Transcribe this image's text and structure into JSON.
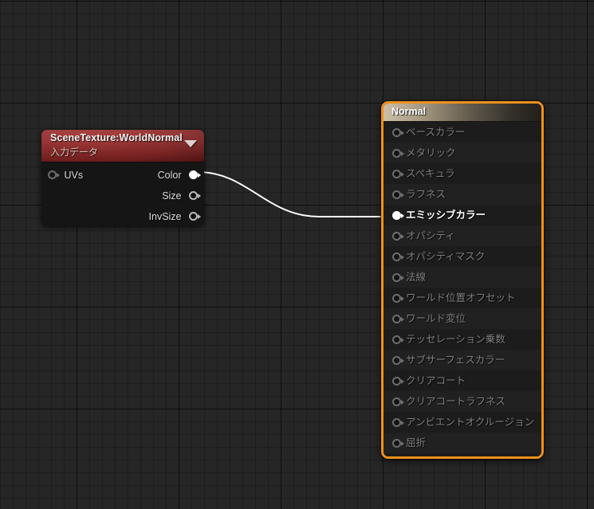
{
  "app": {
    "context": "unreal-engine-material-graph",
    "accent_selection_color": "#f0911a",
    "wire_color": "#ffffff",
    "canvas_color": "#262626"
  },
  "scene_texture_node": {
    "title": "SceneTexture:WorldNormal",
    "subtitle": "入力データ",
    "header_color": "#8d2424",
    "collapse_arrow_icon": "chevron-down-icon",
    "inputs": [
      {
        "label": "UVs",
        "connected": false
      }
    ],
    "outputs": [
      {
        "label": "Color",
        "connected": true
      },
      {
        "label": "Size",
        "connected": false
      },
      {
        "label": "InvSize",
        "connected": false
      }
    ]
  },
  "material_output_node": {
    "title": "Normal",
    "selected": true,
    "inputs": [
      {
        "label": "ベースカラー",
        "connected": false
      },
      {
        "label": "メタリック",
        "connected": false
      },
      {
        "label": "スペキュラ",
        "connected": false
      },
      {
        "label": "ラフネス",
        "connected": false
      },
      {
        "label": "エミッシブカラー",
        "connected": true
      },
      {
        "label": "オパシティ",
        "connected": false
      },
      {
        "label": "オパシティマスク",
        "connected": false
      },
      {
        "label": "法線",
        "connected": false
      },
      {
        "label": "ワールド位置オフセット",
        "connected": false
      },
      {
        "label": "ワールド変位",
        "connected": false
      },
      {
        "label": "テッセレーション乗数",
        "connected": false
      },
      {
        "label": "サブサーフェスカラー",
        "connected": false
      },
      {
        "label": "クリアコート",
        "connected": false
      },
      {
        "label": "クリアコートラフネス",
        "connected": false
      },
      {
        "label": "アンビエントオクルージョン",
        "connected": false
      },
      {
        "label": "屈折",
        "connected": false
      }
    ]
  },
  "connections": [
    {
      "from_node": "SceneTexture:WorldNormal",
      "from_pin": "Color",
      "to_node": "Normal",
      "to_pin": "エミッシブカラー"
    }
  ]
}
